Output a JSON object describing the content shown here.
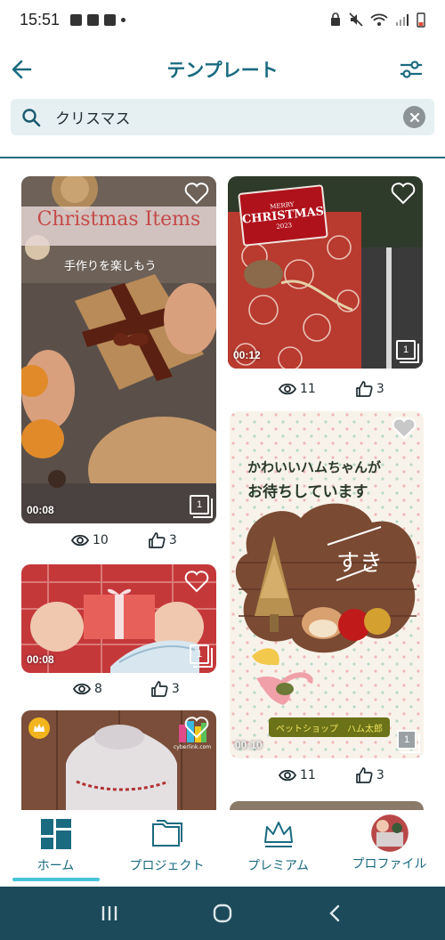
{
  "status_bar": {
    "time": "15:51"
  },
  "header": {
    "title": "テンプレート"
  },
  "search": {
    "query": "クリスマス"
  },
  "cards": [
    {
      "id": "christmas-items",
      "heading": "Christmas Items",
      "sub": "手作りを楽しもう",
      "duration": "00:08",
      "count": "1",
      "views": "10",
      "likes": "3"
    },
    {
      "id": "merry-christmas",
      "banner_top": "MERRY",
      "banner_main": "CHRISTMAS",
      "banner_year": "2023",
      "duration": "00:12",
      "count": "1",
      "views": "11",
      "likes": "3"
    },
    {
      "id": "red-gift",
      "duration": "00:08",
      "count": "1",
      "views": "8",
      "likes": "3"
    },
    {
      "id": "hamster",
      "headline_1": "かわいいハムちゃんが",
      "headline_2": "お待ちしています",
      "bubble_text": "すき",
      "shop_label": "ペットショップ　ハム太郎",
      "duration": "00:10",
      "count": "1",
      "views": "11",
      "likes": "3"
    },
    {
      "id": "sweater",
      "logo_text": "cyberlink.com"
    }
  ],
  "nav": [
    {
      "label": "ホーム",
      "icon": "home-grid-icon",
      "active": true
    },
    {
      "label": "プロジェクト",
      "icon": "folder-icon",
      "active": false
    },
    {
      "label": "プレミアム",
      "icon": "crown-icon",
      "active": false
    },
    {
      "label": "プロファイル",
      "icon": "avatar-icon",
      "active": false
    }
  ],
  "colors": {
    "accent": "#1a6a80",
    "active_bar": "#47c4d8",
    "system_nav": "#1c4a5a"
  }
}
